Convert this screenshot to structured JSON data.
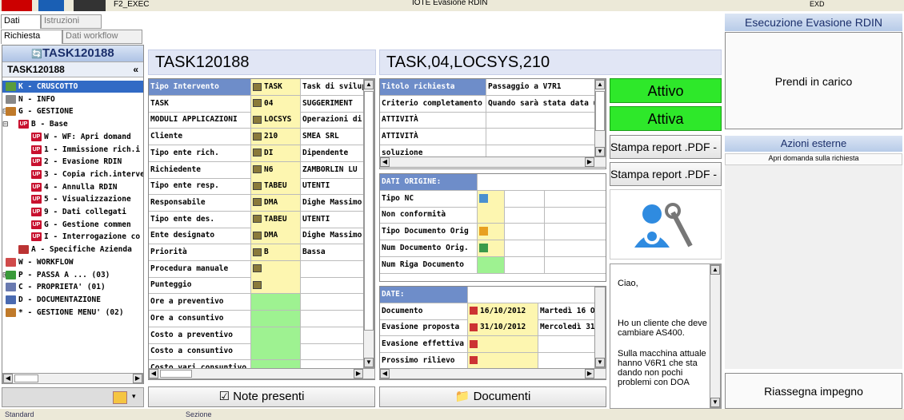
{
  "topbar": {
    "app_label": "F2_EXEC",
    "center_label": "IOTE Evasione RDIN",
    "right_label": "EXD"
  },
  "left_tabs": {
    "row1": [
      "Dati",
      "Istruzioni"
    ],
    "row2": [
      "Richiesta",
      "Dati workflow"
    ]
  },
  "left_panel": {
    "title": "TASK120188",
    "subtitle": "TASK120188",
    "collapse": "«",
    "tree": [
      {
        "label": "K - CRUSCOTTO",
        "icon": "dashboard-icon",
        "depth": 1,
        "selected": true
      },
      {
        "label": "N - INFO",
        "icon": "list-icon",
        "depth": 1
      },
      {
        "label": "G - GESTIONE",
        "icon": "edit-icon",
        "depth": 1,
        "expander": "⊟"
      },
      {
        "label": "B - Base",
        "icon": "up-icon",
        "depth": 2,
        "expander": "⊟"
      },
      {
        "label": "W - WF: Apri domand",
        "icon": "up-icon",
        "depth": 3
      },
      {
        "label": "1 - Immissione rich.i",
        "icon": "up-icon",
        "depth": 3
      },
      {
        "label": "2 - Evasione RDIN",
        "icon": "up-icon",
        "depth": 3
      },
      {
        "label": "3 - Copia rich.interve",
        "icon": "up-icon",
        "depth": 3
      },
      {
        "label": "4 - Annulla RDIN",
        "icon": "up-icon",
        "depth": 3
      },
      {
        "label": "5 - Visualizzazione",
        "icon": "up-icon",
        "depth": 3
      },
      {
        "label": "9 - Dati collegati",
        "icon": "up-icon",
        "depth": 3
      },
      {
        "label": "G - Gestione commen",
        "icon": "up-icon",
        "depth": 3
      },
      {
        "label": "I - Interrogazione co",
        "icon": "up-icon",
        "depth": 3
      },
      {
        "label": "A - Specifiche Azienda",
        "icon": "factory-icon",
        "depth": 2
      },
      {
        "label": "W - WORKFLOW",
        "icon": "workflow-icon",
        "depth": 1
      },
      {
        "label": "P - PASSA A ... (03)",
        "icon": "link-icon",
        "depth": 1,
        "expander": "⊞"
      },
      {
        "label": "C - PROPRIETA' (01)",
        "icon": "properties-icon",
        "depth": 1
      },
      {
        "label": "D - DOCUMENTAZIONE",
        "icon": "document-icon",
        "depth": 1
      },
      {
        "label": "* - GESTIONE MENU' (02)",
        "icon": "edit-icon",
        "depth": 1
      }
    ]
  },
  "task_panel": {
    "title": "TASK120188",
    "rows": [
      {
        "label": "Tipo Intervento",
        "icon": "grid-icon",
        "code": "TASK",
        "desc": "Task di svilupp",
        "header": true
      },
      {
        "label": "TASK",
        "icon": "grid-icon",
        "code": "04",
        "desc": "SUGGERIMENT"
      },
      {
        "label": "MODULI APPLICAZIONI",
        "icon": "module-icon",
        "code": "LOCSYS",
        "desc": "Operazioni di s"
      },
      {
        "label": "Cliente",
        "icon": "person-icon",
        "code": "210",
        "desc": "SMEA SRL"
      },
      {
        "label": "Tipo ente rich.",
        "icon": "users-icon",
        "code": "DI",
        "desc": "Dipendente"
      },
      {
        "label": "Richiedente",
        "icon": "tools-icon",
        "code": "N6",
        "desc": "ZAMBORLIN LU"
      },
      {
        "label": "Tipo ente resp.",
        "icon": "grid-icon",
        "code": "TABEU",
        "desc": "UTENTI"
      },
      {
        "label": "Responsabile",
        "icon": "grid-icon",
        "code": "DMA",
        "desc": "Dighe Massimo"
      },
      {
        "label": "Tipo ente des.",
        "icon": "grid-icon",
        "code": "TABEU",
        "desc": "UTENTI"
      },
      {
        "label": "Ente designato",
        "icon": "grid-icon",
        "code": "DMA",
        "desc": "Dighe Massimo"
      },
      {
        "label": "Priorità",
        "icon": "priority-icon",
        "code": "B",
        "desc": "Bassa"
      },
      {
        "label": "Procedura manuale",
        "icon": "grid-icon",
        "code": "",
        "desc": ""
      },
      {
        "label": "Punteggio",
        "icon": "grid-icon",
        "code": "",
        "desc": ""
      },
      {
        "label": "Ore a preventivo",
        "icon": "",
        "code": "",
        "desc": "",
        "green": true
      },
      {
        "label": "Ore a consuntivo",
        "icon": "",
        "code": "",
        "desc": "",
        "green": true
      },
      {
        "label": "Costo a preventivo",
        "icon": "",
        "code": "",
        "desc": "",
        "green": true
      },
      {
        "label": "Costo a consuntivo",
        "icon": "",
        "code": "",
        "desc": "",
        "green": true
      },
      {
        "label": "Costo vari consuntivo",
        "icon": "",
        "code": "",
        "desc": "",
        "green": true
      }
    ],
    "note_button": "Note presenti"
  },
  "task_title_panel": {
    "title": "TASK,04,LOCSYS,210",
    "info_rows": [
      {
        "label": "Titolo richiesta",
        "value": "Passaggio a V7R1",
        "header": true
      },
      {
        "label": "Criterio completamento",
        "value": "Quando sarà stata data u"
      },
      {
        "label": "ATTIVITÀ",
        "value": ""
      },
      {
        "label": "ATTIVITÀ",
        "value": ""
      },
      {
        "label": "soluzione",
        "value": ""
      }
    ],
    "origin": {
      "header": "DATI ORIGINE:",
      "rows": [
        {
          "label": "Tipo NC",
          "icon": "shapes-icon",
          "yellow": true
        },
        {
          "label": "Non conformità",
          "icon": "",
          "yellow": true
        },
        {
          "label": "Tipo Documento Orig",
          "icon": "doc-orange-icon",
          "yellow": true
        },
        {
          "label": "Num Documento Orig.",
          "icon": "doc-green-icon",
          "yellow": true
        },
        {
          "label": "Num Riga Documento",
          "icon": "",
          "green": true
        }
      ]
    },
    "dates": {
      "header": "DATE:",
      "rows": [
        {
          "label": "Documento",
          "date": "16/10/2012",
          "day": "Martedì 16 O"
        },
        {
          "label": "Evasione proposta",
          "date": "31/10/2012",
          "day": "Mercoledì 31"
        },
        {
          "label": "Evasione effettiva",
          "date": "",
          "day": ""
        },
        {
          "label": "Prossimo rilievo",
          "date": "",
          "day": ""
        }
      ]
    },
    "doc_button": "Documenti"
  },
  "status_panel": {
    "attivo": "Attivo",
    "attiva": "Attiva",
    "report1": "Stampa report .PDF - I",
    "report2": "Stampa report .PDF - E",
    "message": [
      "Ciao,",
      "Ho un cliente che deve cambiare AS400.",
      "Sulla macchina attuale hanno V6R1 che sta dando non pochi problemi con DOA"
    ]
  },
  "right_panel": {
    "title": "Esecuzione Evasione RDIN",
    "take_charge": "Prendi in carico",
    "ext_title": "Azioni esterne",
    "ext_item": "Apri domanda sulla richiesta",
    "reassign": "Riassegna impegno"
  },
  "statusbar": {
    "left": "Standard",
    "mid": "Sezione"
  },
  "colors": {
    "header_blue": "#6e8dc9",
    "green": "#2ee82a",
    "yellow": "#fdf6b0",
    "selection": "#316ac5"
  }
}
